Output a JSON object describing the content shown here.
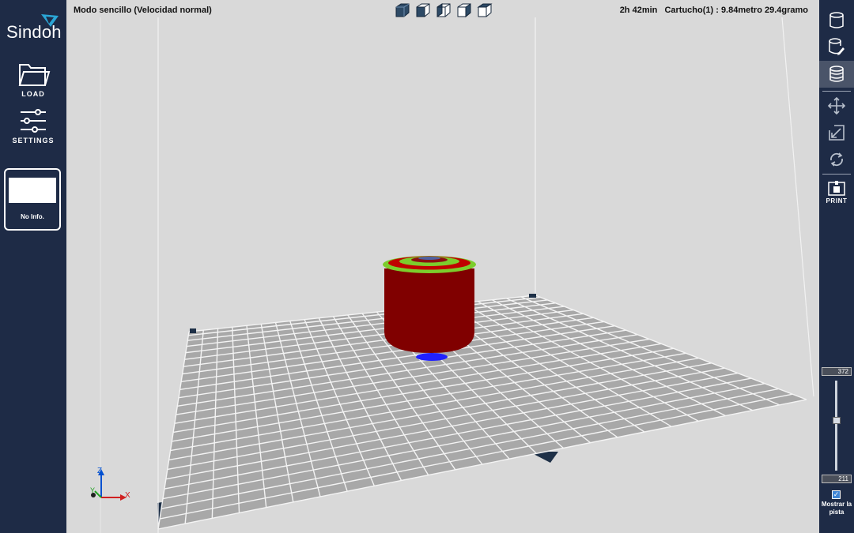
{
  "app": {
    "brand": "Sindoh",
    "mode_label": "Modo sencillo (Velocidad normal)",
    "print_time": "2h 42min",
    "cartridge_info": "Cartucho(1) : 9.84metro 29.4gramo"
  },
  "left_toolbar": {
    "load_label": "LOAD",
    "settings_label": "SETTINGS",
    "info_card_text": "No Info."
  },
  "view_cube_icons": [
    "view-solid-icon",
    "view-front-icon",
    "view-left-icon",
    "view-right-icon",
    "view-top-icon"
  ],
  "right_toolbar": {
    "items": [
      {
        "icon": "cylinder-icon",
        "active": false
      },
      {
        "icon": "cylinder-edit-icon",
        "active": false
      },
      {
        "icon": "layers-icon",
        "active": true
      },
      {
        "icon": "move-icon",
        "active": false
      },
      {
        "icon": "scale-icon",
        "active": false
      },
      {
        "icon": "rotate-icon",
        "active": false
      }
    ],
    "print_label": "PRINT"
  },
  "layer_slider": {
    "max_value": "372",
    "min_value": "211",
    "show_path_label": "Mostrar la pista",
    "show_path_checked": true
  },
  "axes": {
    "x": "X",
    "y": "Y",
    "z": "Z"
  },
  "colors": {
    "sidebar": "#1e2b46",
    "viewport_bg": "#d9d9d9",
    "bed": "#a8a8a8",
    "model_wall": "#800000",
    "model_infill": "#7ccd2c",
    "model_base": "#2020ff"
  }
}
